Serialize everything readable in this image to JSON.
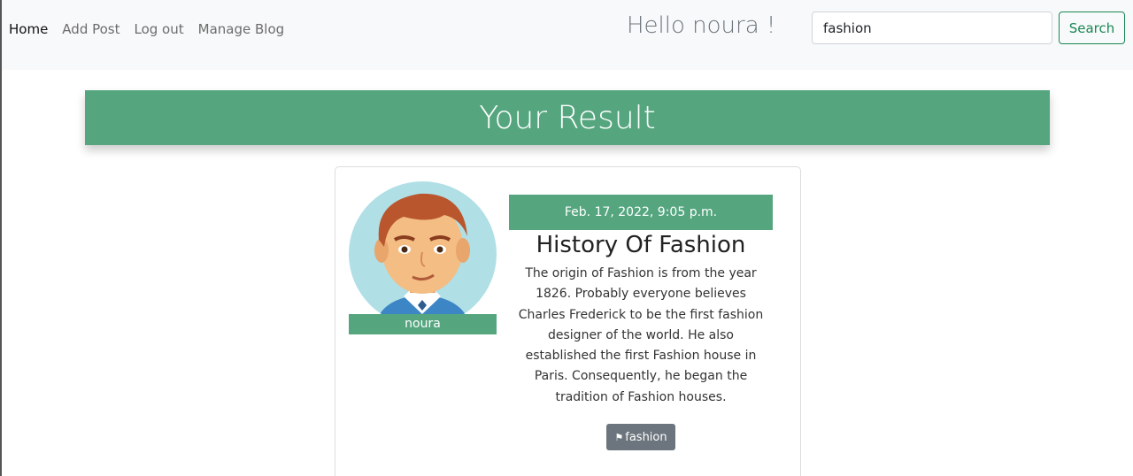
{
  "nav": {
    "links": [
      "Home",
      "Add Post",
      "Log out",
      "Manage Blog"
    ],
    "greeting": "Hello noura !",
    "search": {
      "value": "fashion",
      "button_label": "Search"
    }
  },
  "main": {
    "result_title": "Your Result",
    "post": {
      "author": "noura",
      "date": "Feb. 17, 2022, 9:05 p.m.",
      "title": "History Of Fashion",
      "text": "The origin of Fashion is from the year 1826. Probably everyone believes Charles Frederick to be the first fashion designer of the world. He also established the first Fashion house in Paris. Consequently, he began the tradition of Fashion houses.",
      "tag": "fashion",
      "tag_icon": "tag-icon"
    }
  },
  "colors": {
    "accent_green": "#55a67f",
    "search_green": "#198754",
    "navbar_bg": "#f8f9fa",
    "tag_gray": "#6c757d"
  }
}
